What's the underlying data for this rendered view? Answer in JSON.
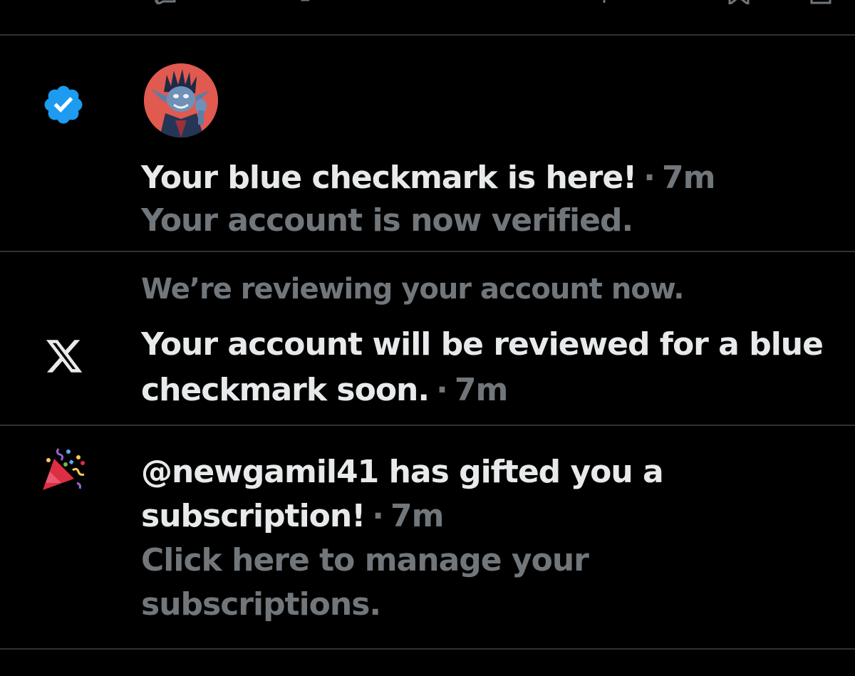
{
  "top_bar": {
    "actions": [
      {
        "name": "reply-icon"
      },
      {
        "name": "retweet-icon"
      },
      {
        "name": "like-icon"
      },
      {
        "name": "views-icon"
      },
      {
        "name": "bookmark-icon"
      },
      {
        "name": "share-icon"
      }
    ]
  },
  "notifications": [
    {
      "icon": "verified-badge-icon",
      "avatar": "goblin-avatar",
      "title": "Your blue checkmark is here!",
      "separator": "·",
      "time": "7m",
      "body": "Your account is now verified."
    },
    {
      "icon": "x-logo-icon",
      "subtitle": "We’re reviewing your account now.",
      "title": "Your account will be reviewed for a blue checkmark soon.",
      "separator": "·",
      "time": "7m"
    },
    {
      "icon": "party-popper-icon",
      "title": "@newgamil41 has gifted you a subscription!",
      "separator": "·",
      "time": "7m",
      "body": "Click here to manage your subscriptions."
    }
  ],
  "colors": {
    "background": "#000000",
    "primary_text": "#e7e9ea",
    "secondary_text": "#71767b",
    "divider": "#2f3336",
    "verified_blue": "#1d9bf0"
  }
}
